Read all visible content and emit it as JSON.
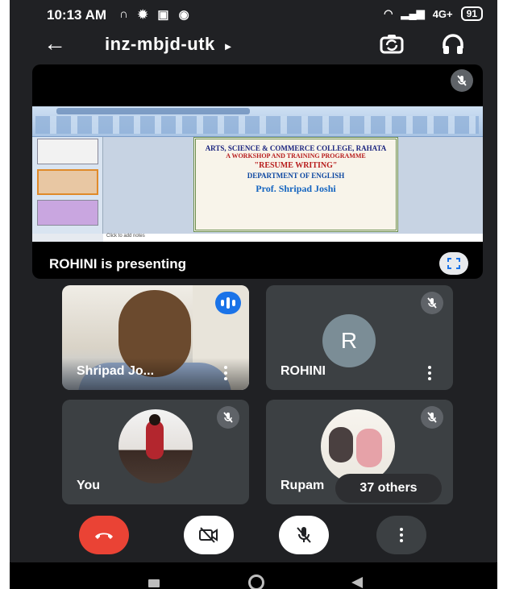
{
  "status_bar": {
    "time": "10:13 AM",
    "network_type": "4G+",
    "battery": "91"
  },
  "header": {
    "back_icon": "arrow-left-icon",
    "meeting_code": "inz-mbjd-utk",
    "meeting_code_chevron": "▸",
    "switch_camera_icon": "switch-camera-icon",
    "audio_output_icon": "headphones-icon"
  },
  "presentation": {
    "label": "ROHINI is presenting",
    "fullscreen_icon": "fullscreen-icon",
    "slide": {
      "line1": "ARTS, SCIENCE & COMMERCE COLLEGE, RAHATA",
      "line2": "A WORKSHOP AND TRAINING PROGRAMME",
      "line3": "\"RESUME WRITING\"",
      "line4": "DEPARTMENT OF ENGLISH",
      "line5": "Prof. Shripad Joshi"
    },
    "notes_placeholder": "Click to add notes"
  },
  "participants": [
    {
      "name": "Shripad Jo...",
      "speaking": true,
      "video": true
    },
    {
      "name": "ROHINI",
      "initial": "R",
      "muted": true
    },
    {
      "name": "You",
      "muted": true
    },
    {
      "name": "Rupam",
      "muted": true
    }
  ],
  "others_pill": "37 others",
  "controls": {
    "end_call_icon": "phone-hangup-icon",
    "camera_icon": "camera-off-icon",
    "mic_icon": "mic-off-icon",
    "more_icon": "more-vertical-icon"
  },
  "colors": {
    "background": "#202124",
    "tile": "#3c4043",
    "end_call": "#ea4335",
    "speaking": "#1a73e8"
  }
}
